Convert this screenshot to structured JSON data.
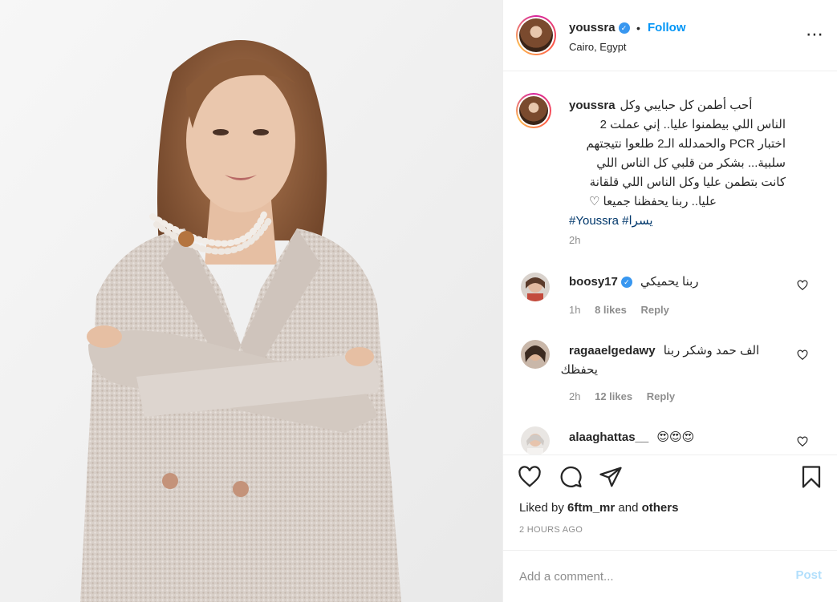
{
  "post": {
    "username": "youssra",
    "follow_separator": "•",
    "follow_label": "Follow",
    "location": "Cairo, Egypt",
    "more_icon": "more-options-icon"
  },
  "caption": {
    "username": "youssra",
    "lines": [
      "أحب أطمن كل حبايبي وكل",
      "الناس اللي بيطمنوا عليا.. إني عملت 2",
      "اختبار PCR والحمدلله الـ2 طلعوا نتيجتهم",
      "سلبية... بشكر من قلبي كل الناس اللي",
      "كانت بتطمن عليا وكل الناس اللي قلقانة",
      "عليا.. ربنا يحفظنا جميعا ♡"
    ],
    "hashtags": "#Youssra #يسرا",
    "time": "2h"
  },
  "comments": [
    {
      "username": "boosy17",
      "verified": true,
      "text": "ربنا يحميكي",
      "time": "1h",
      "likes": "8 likes",
      "reply": "Reply"
    },
    {
      "username": "ragaaelgedawy",
      "verified": false,
      "text_line1": "الف حمد وشكر ربنا",
      "text_line2": "يحفظك",
      "time": "2h",
      "likes": "12 likes",
      "reply": "Reply"
    },
    {
      "username": "alaaghattas__",
      "verified": false,
      "text": "😍😍😍"
    }
  ],
  "actions": {
    "like_icon": "heart-icon",
    "comment_icon": "comment-icon",
    "share_icon": "share-icon",
    "save_icon": "bookmark-icon"
  },
  "likes": {
    "prefix": "Liked by",
    "user": "6ftm_mr",
    "conj": "and",
    "others": "others"
  },
  "posted_ago": "2 HOURS AGO",
  "add_comment": {
    "placeholder": "Add a comment...",
    "post_label": "Post"
  },
  "colors": {
    "accent": "#0095f6",
    "hashtag": "#00376b",
    "muted": "#8e8e8e",
    "post_disabled": "#b2dffc"
  }
}
